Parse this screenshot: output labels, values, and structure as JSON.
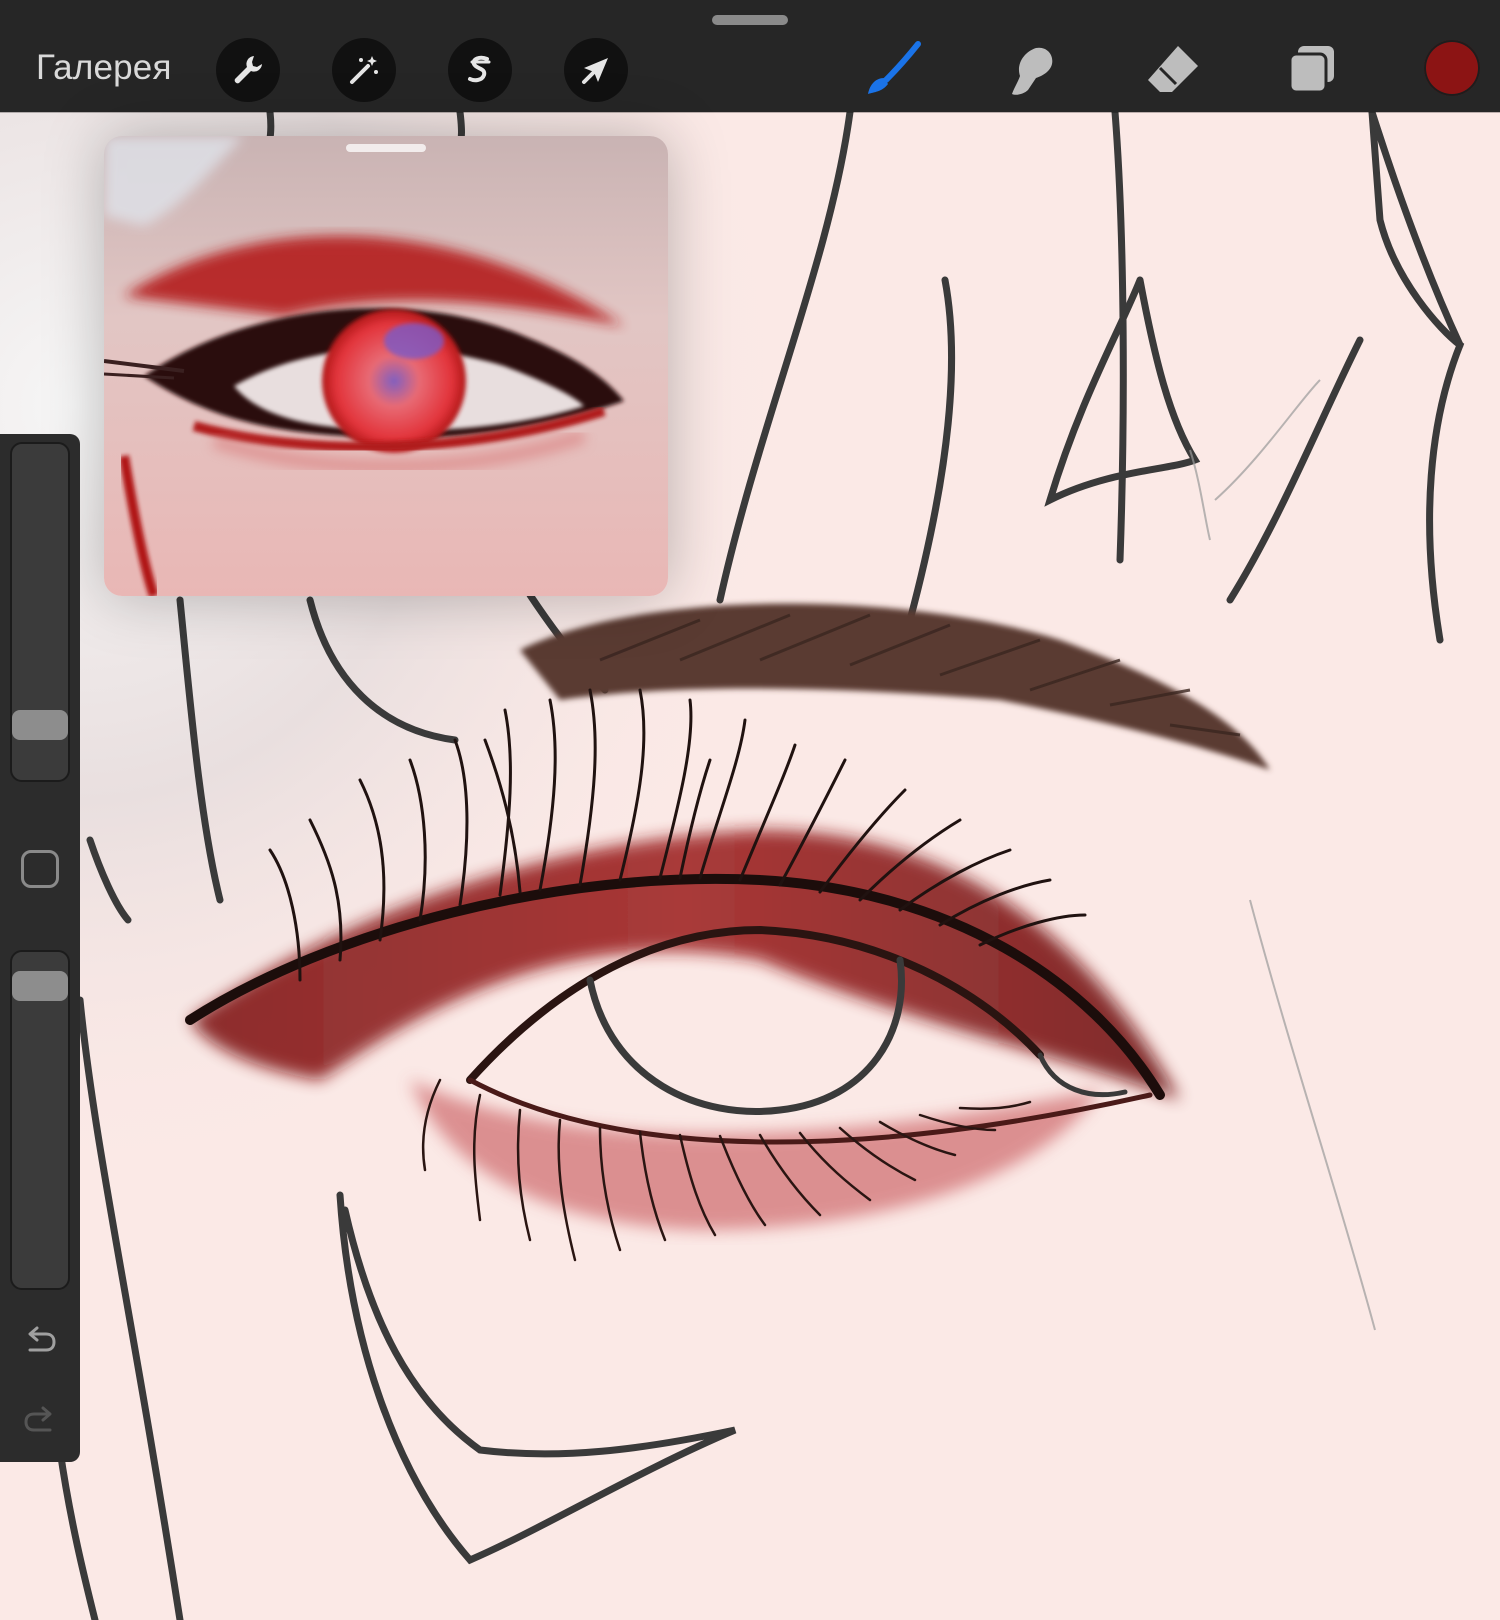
{
  "app": {
    "gallery_label": "Галерея"
  },
  "toolbar": {
    "actions": [
      {
        "name": "wrench-icon"
      },
      {
        "name": "magic-wand-icon"
      },
      {
        "name": "selection-icon"
      },
      {
        "name": "transform-arrow-icon"
      }
    ],
    "tools": [
      {
        "name": "brush-icon",
        "active": true
      },
      {
        "name": "smudge-icon",
        "active": false
      },
      {
        "name": "eraser-icon",
        "active": false
      },
      {
        "name": "layers-icon",
        "active": false
      }
    ],
    "current_color": "#8c1414"
  },
  "sidebar": {
    "brush_size_level": 0.12,
    "opacity_level": 0.95,
    "undo_icon": "undo-icon",
    "redo_icon": "redo-icon"
  },
  "colors": {
    "toolbar_bg": "#262626",
    "accent_active": "#1a73e8",
    "skin": "#fbe9e6",
    "lineart": "#3a3a3a",
    "makeup_red": "#8c1414"
  }
}
